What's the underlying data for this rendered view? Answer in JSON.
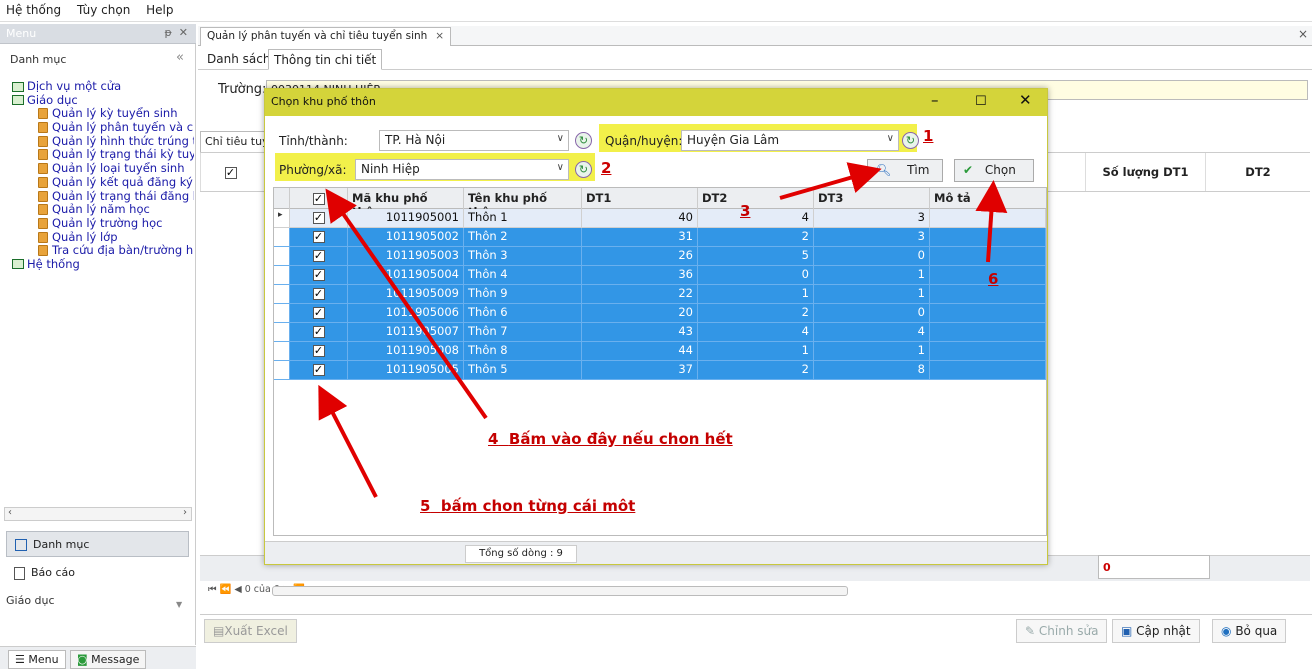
{
  "menubar": [
    "Hệ thống",
    "Tùy chọn",
    "Help"
  ],
  "left_panel": {
    "title": "Menu",
    "pin": "ᵽ",
    "category": "Danh mục",
    "tree": [
      {
        "label": "Dịch vụ một cửa",
        "level": 0
      },
      {
        "label": "Giáo dục",
        "level": 0
      },
      {
        "label": "Quản lý kỳ tuyển sinh",
        "level": 1
      },
      {
        "label": "Quản lý phân tuyến và ch",
        "level": 1
      },
      {
        "label": "Quản lý hình thức trúng t",
        "level": 1
      },
      {
        "label": "Quản lý trạng thái kỳ tuy",
        "level": 1
      },
      {
        "label": "Quản lý loại tuyển sinh",
        "level": 1
      },
      {
        "label": "Quản lý kết quả đăng ký",
        "level": 1
      },
      {
        "label": "Quản lý trạng thái đăng k",
        "level": 1
      },
      {
        "label": "Quản lý năm học",
        "level": 1
      },
      {
        "label": "Quản lý trường học",
        "level": 1
      },
      {
        "label": "Quản lý lớp",
        "level": 1
      },
      {
        "label": "Tra cứu địa bàn/trường h",
        "level": 1
      },
      {
        "label": "Hệ thống",
        "level": 0
      }
    ],
    "nav_buttons": [
      "Danh mục",
      "Báo cáo"
    ],
    "nav_label": "Giáo dục",
    "footer_tabs": [
      "Menu",
      "Message"
    ]
  },
  "doc_tab": "Quản lý phân tuyến và chỉ tiêu tuyển sinh",
  "sub_tabs": [
    "Danh sách",
    "Thông tin chi tiết"
  ],
  "form": {
    "truong_label": "Trường:",
    "truong_value": "0030114 NINH HIỆP",
    "chitieu_tab": "Chỉ tiêu tuy"
  },
  "bg_grid": {
    "headers": [
      "Số lượng DT1",
      "DT2"
    ],
    "footer_value": "0"
  },
  "pager_text": "⏮ ⏪ ◀ 0 của 0 ▶ ⏩ ⏭ ◂",
  "bottom_buttons": [
    "Xuất Excel",
    "Chỉnh sửa",
    "Cập nhật",
    "Bỏ qua"
  ],
  "dialog": {
    "title": "Chọn khu phố thôn",
    "tinh_label": "Tỉnh/thành:",
    "tinh_value": "TP. Hà Nội",
    "quan_label": "Quận/huyện:",
    "quan_value": "Huyện Gia Lâm",
    "phuong_label": "Phường/xã:",
    "phuong_value": "Ninh Hiệp",
    "btn_tim": "Tìm",
    "btn_chon": "Chọn",
    "columns": [
      "Mã khu phố thôn",
      "Tên khu phố thôn",
      "DT1",
      "DT2",
      "DT3",
      "Mô tả"
    ],
    "rows": [
      {
        "ma": "1011905001",
        "ten": "Thôn 1",
        "dt1": "40",
        "dt2": "4",
        "dt3": "3",
        "mota": ""
      },
      {
        "ma": "1011905002",
        "ten": "Thôn 2",
        "dt1": "31",
        "dt2": "2",
        "dt3": "3",
        "mota": ""
      },
      {
        "ma": "1011905003",
        "ten": "Thôn 3",
        "dt1": "26",
        "dt2": "5",
        "dt3": "0",
        "mota": ""
      },
      {
        "ma": "1011905004",
        "ten": "Thôn 4",
        "dt1": "36",
        "dt2": "0",
        "dt3": "1",
        "mota": ""
      },
      {
        "ma": "1011905009",
        "ten": "Thôn 9",
        "dt1": "22",
        "dt2": "1",
        "dt3": "1",
        "mota": ""
      },
      {
        "ma": "1011905006",
        "ten": "Thôn 6",
        "dt1": "20",
        "dt2": "2",
        "dt3": "0",
        "mota": ""
      },
      {
        "ma": "1011905007",
        "ten": "Thôn 7",
        "dt1": "43",
        "dt2": "4",
        "dt3": "4",
        "mota": ""
      },
      {
        "ma": "1011905008",
        "ten": "Thôn 8",
        "dt1": "44",
        "dt2": "1",
        "dt3": "1",
        "mota": ""
      },
      {
        "ma": "1011905005",
        "ten": "Thôn 5",
        "dt1": "37",
        "dt2": "2",
        "dt3": "8",
        "mota": ""
      }
    ],
    "footer": "Tổng số dòng : 9"
  },
  "annotations": {
    "n1": "1",
    "n2": "2",
    "n3": "3",
    "n4": "4",
    "n4_text": "Bấm vào đây nếu chon hết",
    "n5": "5",
    "n5_text": "bấm chon từng cái môt",
    "n6": "6"
  },
  "colors": {
    "dialog_title": "#d4d43a",
    "highlight": "#f2f04a",
    "selection": "#3296e6",
    "annotation": "#c40000"
  }
}
